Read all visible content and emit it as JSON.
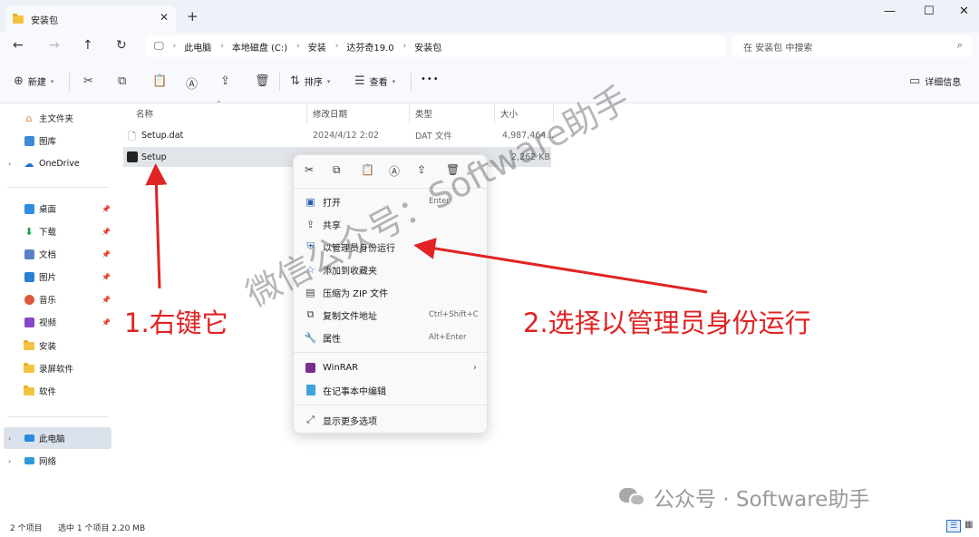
{
  "window": {
    "tab_title": "安装包",
    "new_tab": "+",
    "tab_close": "✕",
    "minimize": "—",
    "maximize": "☐",
    "close": "✕"
  },
  "address_bar": {
    "breadcrumbs": [
      "此电脑",
      "本地磁盘 (C:)",
      "安装",
      "达芬奇19.0",
      "安装包"
    ],
    "search_placeholder": "在 安装包 中搜索"
  },
  "toolbar": {
    "new_label": "新建",
    "sort_label": "排序",
    "view_label": "查看",
    "more_label": "•••",
    "details_label": "详细信息"
  },
  "sidebar": {
    "home": "主文件夹",
    "gallery": "图库",
    "onedrive": "OneDrive",
    "desktop": "桌面",
    "downloads": "下载",
    "documents": "文档",
    "pictures": "图片",
    "music": "音乐",
    "videos": "视频",
    "install": "安装",
    "recorder": "录屏软件",
    "software": "软件",
    "this_pc": "此电脑",
    "network": "网络"
  },
  "columns": {
    "name": "名称",
    "modified": "修改日期",
    "type": "类型",
    "size": "大小"
  },
  "files": [
    {
      "name": "Setup.dat",
      "modified": "2024/4/12 2:02",
      "type": "DAT 文件",
      "size": "4,987,464..."
    },
    {
      "name": "Setup",
      "modified": "",
      "type": "",
      "size": "2,262 KB"
    }
  ],
  "context_menu": {
    "items": [
      {
        "label": "打开",
        "shortcut": "Enter"
      },
      {
        "label": "共享",
        "shortcut": ""
      },
      {
        "label": "以管理员身份运行",
        "shortcut": ""
      },
      {
        "label": "添加到收藏夹",
        "shortcut": ""
      },
      {
        "label": "压缩为 ZIP 文件",
        "shortcut": ""
      },
      {
        "label": "复制文件地址",
        "shortcut": "Ctrl+Shift+C"
      },
      {
        "label": "属性",
        "shortcut": "Alt+Enter"
      },
      {
        "label": "WinRAR",
        "shortcut": ""
      },
      {
        "label": "在记事本中编辑",
        "shortcut": ""
      },
      {
        "label": "显示更多选项",
        "shortcut": ""
      }
    ]
  },
  "status_bar": {
    "count": "2 个项目",
    "selected": "选中 1 个项目  2.20 MB"
  },
  "annotations": {
    "step1": "1.右键它",
    "step2": "2.选择以管理员身份运行",
    "watermark": "微信公众号：Software助手",
    "footer_watermark": "公众号 · Software助手"
  },
  "colors": {
    "annotation_red": "#e02323",
    "folder_yellow": "#f5c342",
    "selection": "#e1e4e8"
  }
}
